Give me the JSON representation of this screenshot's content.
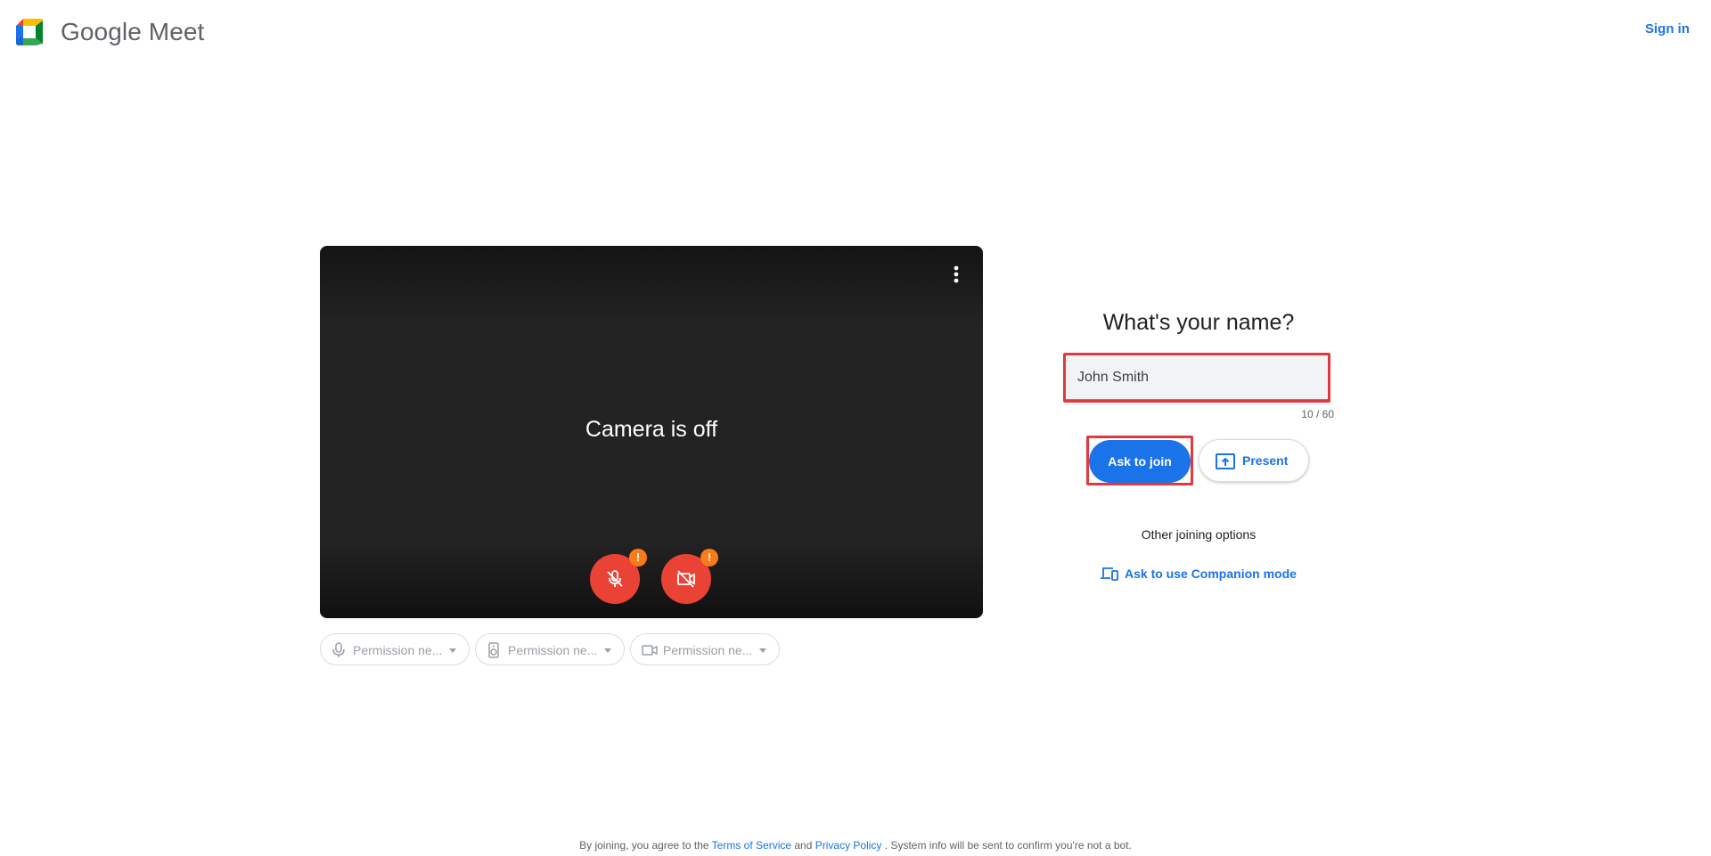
{
  "header": {
    "brand": "Google Meet",
    "sign_in": "Sign in"
  },
  "preview": {
    "camera_status": "Camera is off"
  },
  "chips": [
    {
      "label": "Permission ne...",
      "icon": "microphone-icon"
    },
    {
      "label": "Permission ne...",
      "icon": "speaker-icon"
    },
    {
      "label": "Permission ne...",
      "icon": "camera-icon"
    }
  ],
  "join": {
    "question": "What's your name?",
    "name_value": "John Smith",
    "char_counter": "10 / 60",
    "ask_to_join": "Ask to join",
    "present": "Present",
    "other_options": "Other joining options",
    "companion_mode": "Ask to use Companion mode"
  },
  "footer": {
    "prefix": "By joining, you agree to the",
    "terms": "Terms of Service",
    "and": "and",
    "privacy": "Privacy Policy",
    "suffix": ". System info will be sent to confirm you're not a bot."
  },
  "colors": {
    "accent": "#1a73e8",
    "danger": "#ea4335",
    "warning": "#fa7b17",
    "highlight_box": "#e0393e"
  }
}
